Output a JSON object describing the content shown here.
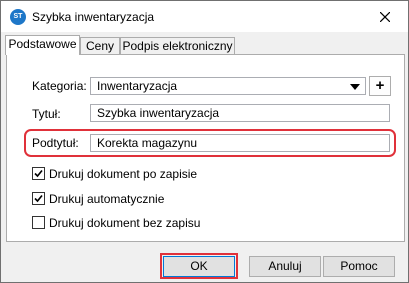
{
  "window": {
    "title": "Szybka inwentaryzacja",
    "icon": "app-logo-icon",
    "icon_text": "ST"
  },
  "tabs": [
    {
      "label": "Podstawowe",
      "active": true
    },
    {
      "label": "Ceny",
      "active": false
    },
    {
      "label": "Podpis elektroniczny",
      "active": false
    }
  ],
  "form": {
    "kategoria": {
      "label": "Kategoria:",
      "value": "Inwentaryzacja"
    },
    "tytul": {
      "label": "Tytuł:",
      "value": "Szybka inwentaryzacja"
    },
    "podtytul": {
      "label": "Podtytuł:",
      "value": "Korekta magazynu"
    },
    "add_button_label": "+"
  },
  "checkboxes": [
    {
      "label": "Drukuj dokument po zapisie",
      "checked": true
    },
    {
      "label": "Drukuj automatycznie",
      "checked": true
    },
    {
      "label": "Drukuj dokument bez zapisu",
      "checked": false
    }
  ],
  "buttons": {
    "ok": "OK",
    "cancel": "Anuluj",
    "help": "Pomoc"
  },
  "colors": {
    "highlight": "#e0313a",
    "accent": "#0078d7"
  }
}
